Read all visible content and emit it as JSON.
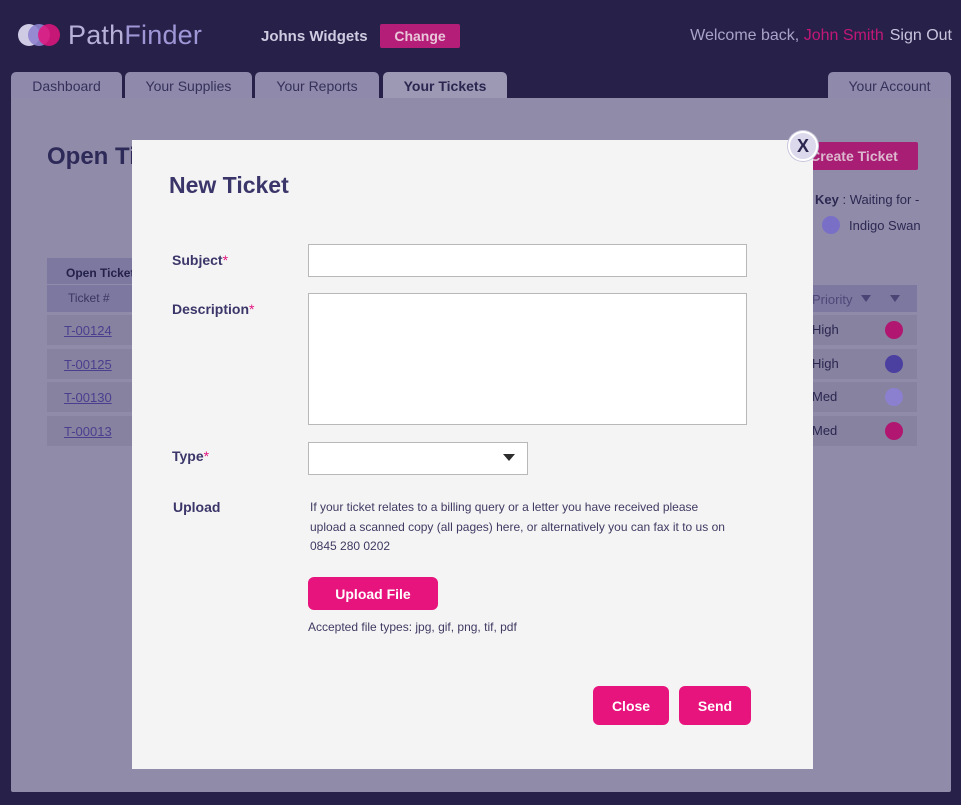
{
  "header": {
    "logo_part1": "Path",
    "logo_part2": "Finder",
    "company": "Johns Widgets",
    "change_label": "Change",
    "welcome_prefix": "Welcome back, ",
    "user_name": "John Smith",
    "signout_label": "Sign Out"
  },
  "tabs": [
    {
      "label": "Dashboard"
    },
    {
      "label": "Your Supplies"
    },
    {
      "label": "Your Reports"
    },
    {
      "label": "Your Tickets"
    },
    {
      "label": "Your Account"
    }
  ],
  "page": {
    "title": "Open Ti",
    "create_label": "Create Ticket",
    "key_label": "Key",
    "key_text": " : Waiting for -",
    "legend_name": "Indigo Swan"
  },
  "table": {
    "heading": "Open Ticket",
    "col_ticket": "Ticket #",
    "col_priority": "Priority",
    "rows": [
      {
        "ticket": "T-00124",
        "priority": "High",
        "color": "#b11670"
      },
      {
        "ticket": "T-00125",
        "priority": "High",
        "color": "#4b3fa0"
      },
      {
        "ticket": "T-00130",
        "priority": "Med",
        "color": "#8a80cf"
      },
      {
        "ticket": "T-00013",
        "priority": "Med",
        "color": "#b11670"
      }
    ]
  },
  "modal": {
    "close_x": "X",
    "title": "New Ticket",
    "subject_label": "Subject",
    "description_label": "Description",
    "type_label": "Type",
    "required_mark": "*",
    "subject_value": "",
    "description_value": "",
    "type_value": "",
    "upload_label": "Upload",
    "upload_text": "If your ticket relates to a billing query or a letter you have received please upload a scanned copy (all pages) here, or  alternatively you can fax it to us on 0845 280 0202",
    "upload_button": "Upload File",
    "accepted_types": "Accepted file types: jpg, gif, png, tif, pdf",
    "close_button": "Close",
    "send_button": "Send"
  },
  "colors": {
    "accent": "#e8147e",
    "background": "#27214a",
    "modal": "#f4f4f4"
  }
}
